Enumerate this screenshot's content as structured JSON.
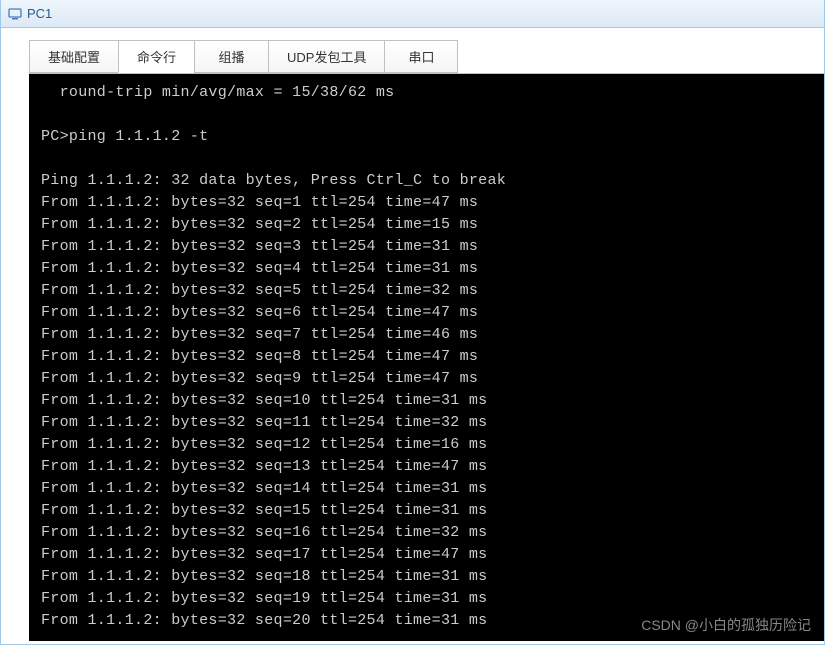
{
  "window": {
    "title": "PC1"
  },
  "tabs": [
    {
      "label": "基础配置",
      "active": false
    },
    {
      "label": "命令行",
      "active": true
    },
    {
      "label": "组播",
      "active": false
    },
    {
      "label": "UDP发包工具",
      "active": false
    },
    {
      "label": "串口",
      "active": false
    }
  ],
  "terminal": {
    "summary": "  round-trip min/avg/max = 15/38/62 ms",
    "prompt": "PC>",
    "command": "ping 1.1.1.2 -t",
    "header": "Ping 1.1.1.2: 32 data bytes, Press Ctrl_C to break",
    "target": "1.1.1.2",
    "bytes": 32,
    "ttl": 254,
    "replies": [
      {
        "seq": 1,
        "time": 47
      },
      {
        "seq": 2,
        "time": 15
      },
      {
        "seq": 3,
        "time": 31
      },
      {
        "seq": 4,
        "time": 31
      },
      {
        "seq": 5,
        "time": 32
      },
      {
        "seq": 6,
        "time": 47
      },
      {
        "seq": 7,
        "time": 46
      },
      {
        "seq": 8,
        "time": 47
      },
      {
        "seq": 9,
        "time": 47
      },
      {
        "seq": 10,
        "time": 31
      },
      {
        "seq": 11,
        "time": 32
      },
      {
        "seq": 12,
        "time": 16
      },
      {
        "seq": 13,
        "time": 47
      },
      {
        "seq": 14,
        "time": 31
      },
      {
        "seq": 15,
        "time": 31
      },
      {
        "seq": 16,
        "time": 32
      },
      {
        "seq": 17,
        "time": 47
      },
      {
        "seq": 18,
        "time": 31
      },
      {
        "seq": 19,
        "time": 31
      },
      {
        "seq": 20,
        "time": 31
      }
    ]
  },
  "watermark": "CSDN @小白的孤独历险记"
}
